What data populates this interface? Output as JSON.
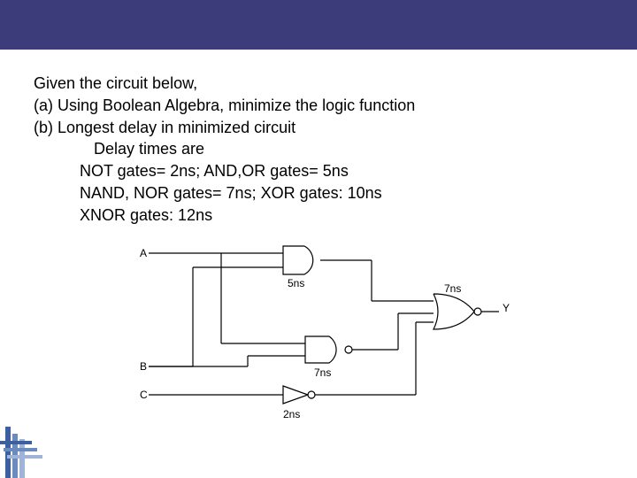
{
  "problem": {
    "intro": "Given the circuit below,",
    "part_a": "(a) Using Boolean Algebra, minimize the logic function",
    "part_b": "(b) Longest delay in minimized circuit",
    "delay_heading": "Delay times are",
    "delay_line1": "NOT gates= 2ns;  AND,OR gates= 5ns",
    "delay_line2": "NAND, NOR gates= 7ns; XOR gates: 10ns",
    "delay_line3": "XNOR gates: 12ns"
  },
  "circuit": {
    "inputs": {
      "a": "A",
      "b": "B",
      "c": "C"
    },
    "output": "Y",
    "gates": {
      "and_top": "5ns",
      "nand_mid": "7ns",
      "not_bot": "2ns",
      "nor_out": "7ns"
    }
  }
}
